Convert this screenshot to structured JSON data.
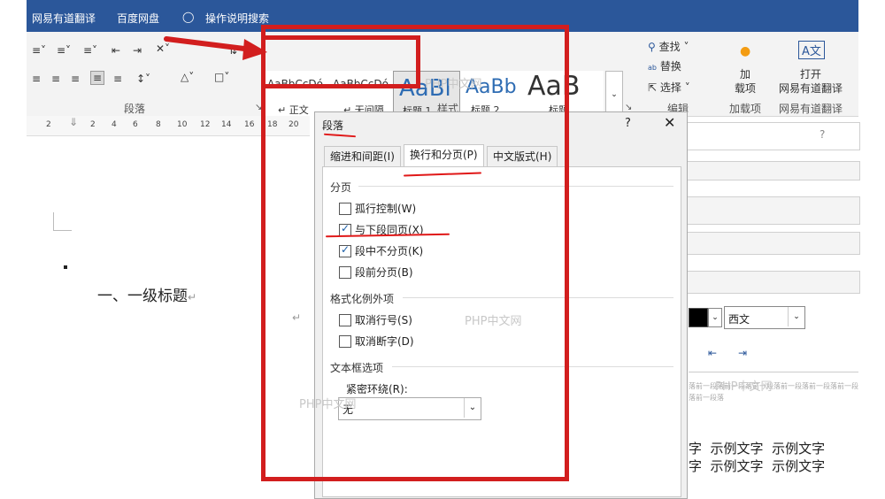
{
  "topbar": {
    "items": [
      "网易有道翻译",
      "百度网盘",
      "操作说明搜索"
    ]
  },
  "ribbon": {
    "paragraph_group": "段落",
    "styles_group": "样式",
    "styles": [
      {
        "sample": "AaBbCcDó",
        "name": "↵ 正文"
      },
      {
        "sample": "AaBbCcDó",
        "name": "↵ 无间隔"
      },
      {
        "sample": "AaBl",
        "name": "标题 1"
      },
      {
        "sample": "AaBb",
        "name": "标题 2"
      },
      {
        "sample": "AaB",
        "name": "标题"
      }
    ],
    "edit": {
      "find": "查找",
      "replace": "替换",
      "select": "选择",
      "group": "编辑"
    },
    "addin": {
      "label": "加\n载项",
      "group": "加载项"
    },
    "youdao": {
      "label": "打开\n网易有道翻译",
      "group": "网易有道翻译"
    }
  },
  "ruler": [
    "2",
    "2",
    "4",
    "6",
    "8",
    "10",
    "12",
    "14",
    "16",
    "18",
    "20"
  ],
  "document": {
    "heading": "一、一级标题"
  },
  "dialog": {
    "title": "段落",
    "help": "?",
    "close": "✕",
    "tabs": [
      "缩进和间距(I)",
      "换行和分页(P)",
      "中文版式(H)"
    ],
    "pagination_section": "分页",
    "pagination_options": [
      {
        "label": "孤行控制(W)",
        "checked": false
      },
      {
        "label": "与下段同页(X)",
        "checked": true
      },
      {
        "label": "段中不分页(K)",
        "checked": true
      },
      {
        "label": "段前分页(B)",
        "checked": false
      }
    ],
    "format_section": "格式化例外项",
    "format_options": [
      {
        "label": "取消行号(S)",
        "checked": false
      },
      {
        "label": "取消断字(D)",
        "checked": false
      }
    ],
    "textbox_section": "文本框选项",
    "tight_wrap_label": "紧密环绕(R):",
    "tight_wrap_value": "无"
  },
  "right_panel": {
    "font_script": "西文",
    "sample_text": [
      "字  示例文字  示例文字",
      "字  示例文字  示例文字"
    ],
    "preview_text": "落前一段落前一段落前一段落前一段落前一段落前一段落前一段落",
    "help": "?"
  },
  "watermark": "PHP中文网"
}
